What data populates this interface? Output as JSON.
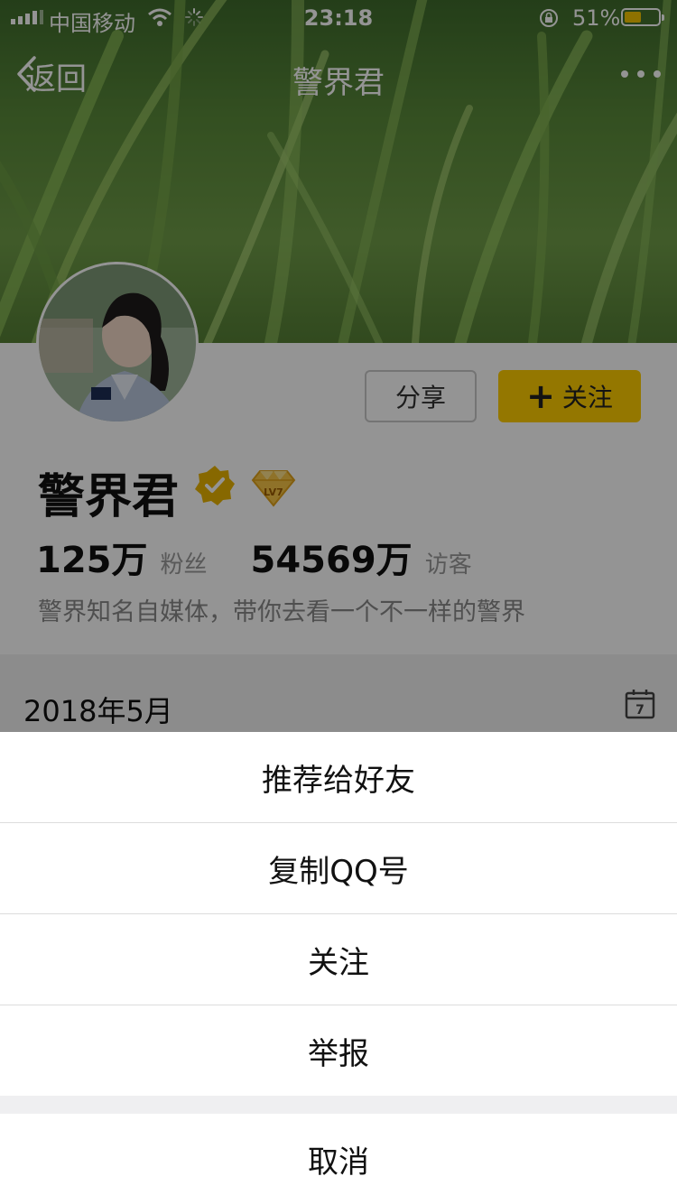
{
  "status_bar": {
    "carrier": "中国移动",
    "time": "23:18",
    "battery_percent": "51%",
    "battery_level": 0.51,
    "battery_color": "#f5c400"
  },
  "nav": {
    "back_label": "返回",
    "title": "警界君"
  },
  "profile": {
    "name": "警界君",
    "share_label": "分享",
    "follow_label": "关注",
    "level_label": "LV7",
    "fans_count": "125万",
    "fans_label": "粉丝",
    "visitors_count": "54569万",
    "visitors_label": "访客",
    "bio": "警界知名自媒体，带你去看一个不一样的警界",
    "accent_color": "#ffcd00"
  },
  "timeline": {
    "month": "2018年5月",
    "calendar_day": "7"
  },
  "action_sheet": {
    "items": [
      {
        "label": "推荐给好友"
      },
      {
        "label": "复制QQ号"
      },
      {
        "label": "关注"
      },
      {
        "label": "举报"
      }
    ],
    "cancel_label": "取消"
  }
}
